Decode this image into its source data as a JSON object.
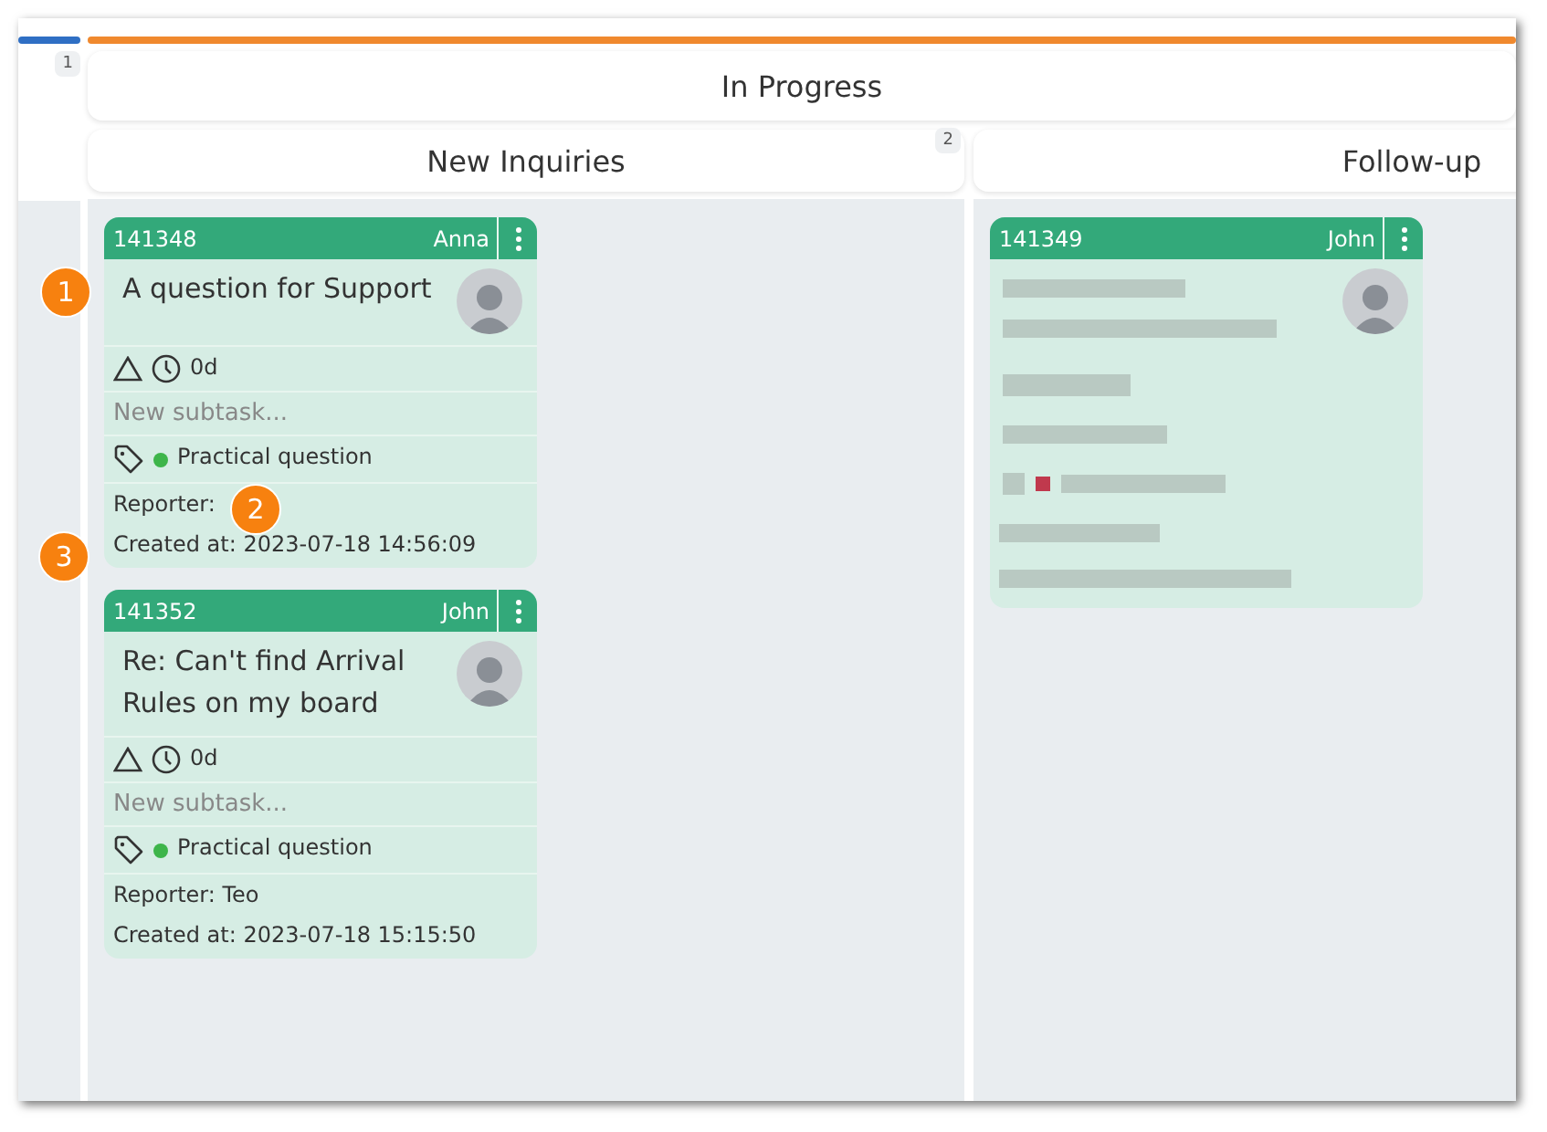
{
  "lanes": [
    {
      "badge": "1",
      "color": "#2f6fc4"
    },
    {
      "title": "In Progress",
      "color": "#f0892e"
    }
  ],
  "columns": [
    {
      "title": "New Inquiries",
      "badge": "2",
      "cards": [
        {
          "kind": "full",
          "id": "141348",
          "assignee": "Anna",
          "title": "A question for Support",
          "age": "0d",
          "subtask": {
            "placeholder": "New subtask..."
          },
          "tag": {
            "label": "Practical question",
            "color": "#3db54a"
          },
          "reporter": "Reporter:",
          "created": "Created at: 2023-07-18 14:56:09",
          "markers": {
            "title": "1",
            "reporter": "2",
            "created": "3"
          }
        },
        {
          "kind": "full",
          "id": "141352",
          "assignee": "John",
          "title": "Re: Can't find Arrival Rules on my board",
          "age": "0d",
          "subtask": {
            "placeholder": "New subtask..."
          },
          "tag": {
            "label": "Practical question",
            "color": "#3db54a"
          },
          "reporter": "Reporter: Teo",
          "created": "Created at: 2023-07-18 15:15:50"
        }
      ]
    },
    {
      "title": "Follow-up",
      "cards": [
        {
          "kind": "blurred",
          "id": "141349",
          "assignee": "John"
        }
      ]
    }
  ]
}
